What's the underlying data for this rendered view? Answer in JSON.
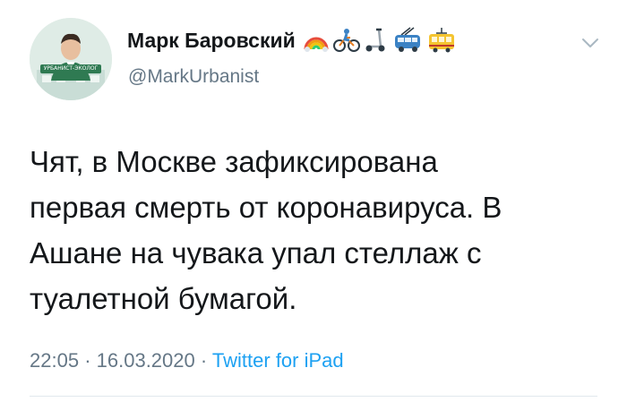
{
  "author": {
    "display_name": "Марк Баровский",
    "handle": "@MarkUrbanist",
    "avatar_badge": "УРБАНИСТ-ЭКОЛОГ",
    "emojis": [
      "rainbow-emoji",
      "cyclist-emoji",
      "kick-scooter-emoji",
      "trolleybus-emoji",
      "tram-emoji"
    ]
  },
  "tweet": {
    "lines": [
      "Чят, в Москве зафиксирована",
      "первая смерть от коронавируса. В",
      "Ашане на чувака упал стеллаж с",
      "туалетной бумагой."
    ]
  },
  "meta": {
    "time": "22:05",
    "separator": "·",
    "date": "16.03.2020",
    "source": "Twitter for iPad"
  },
  "colors": {
    "text": "#14171a",
    "secondary": "#657786",
    "link": "#1da1f2",
    "divider": "#e1e8ed"
  },
  "icons": {
    "menu": "chevron-down-icon"
  }
}
